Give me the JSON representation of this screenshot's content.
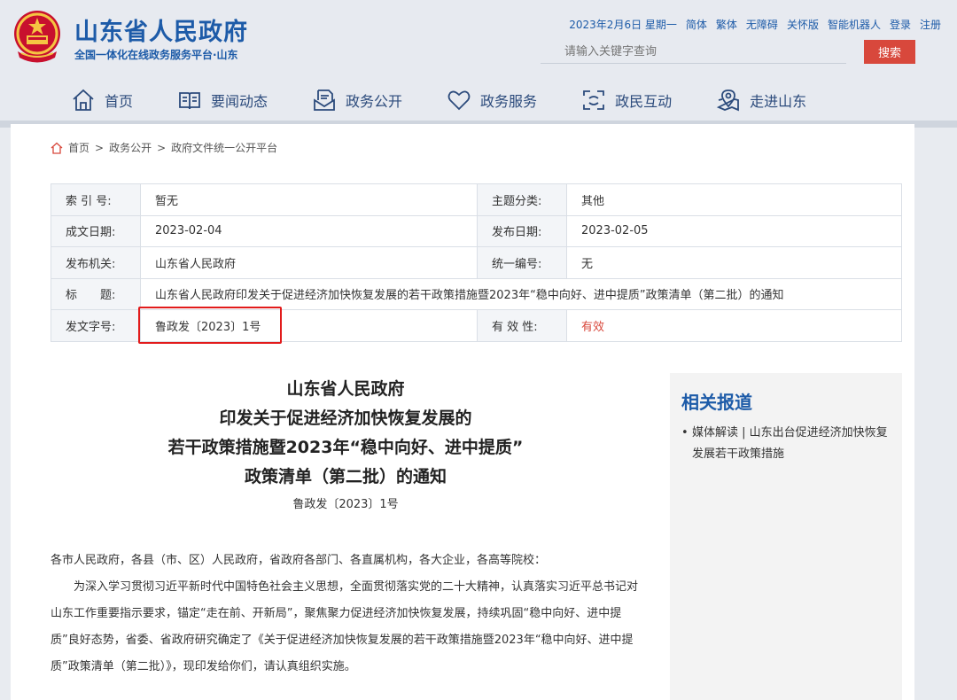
{
  "header": {
    "site_title": "山东省人民政府",
    "site_subtitle": "全国一体化在线政务服务平台·山东",
    "date": "2023年2月6日 星期一",
    "links": [
      "简体",
      "繁体",
      "无障碍",
      "关怀版",
      "智能机器人",
      "登录",
      "注册"
    ],
    "search_placeholder": "请输入关键字查询",
    "search_button": "搜索"
  },
  "nav": [
    {
      "label": "首页",
      "icon": "home-icon"
    },
    {
      "label": "要闻动态",
      "icon": "book-icon"
    },
    {
      "label": "政务公开",
      "icon": "document-icon"
    },
    {
      "label": "政务服务",
      "icon": "heart-icon"
    },
    {
      "label": "政民互动",
      "icon": "interaction-icon"
    },
    {
      "label": "走进山东",
      "icon": "map-pin-icon"
    }
  ],
  "breadcrumb": [
    "首页",
    ">",
    "政务公开",
    ">",
    "政府文件统一公开平台"
  ],
  "meta": {
    "index_label": "索 引 号:",
    "index_value": "暂无",
    "topic_label": "主题分类:",
    "topic_value": "其他",
    "created_label": "成文日期:",
    "created_value": "2023-02-04",
    "published_label": "发布日期:",
    "published_value": "2023-02-05",
    "org_label": "发布机关:",
    "org_value": "山东省人民政府",
    "code_label": "统一编号:",
    "code_value": "无",
    "title_label": "标　　题:",
    "title_value": "山东省人民政府印发关于促进经济加快恢复发展的若干政策措施暨2023年“稳中向好、进中提质”政策清单（第二批）的通知",
    "docnum_label": "发文字号:",
    "docnum_value": "鲁政发〔2023〕1号",
    "validity_label": "有 效 性:",
    "validity_value": "有效"
  },
  "document": {
    "title_lines": [
      "山东省人民政府",
      "印发关于促进经济加快恢复发展的",
      "若干政策措施暨2023年“稳中向好、进中提质”",
      "政策清单（第二批）的通知"
    ],
    "number": "鲁政发〔2023〕1号",
    "salutation": "各市人民政府，各县（市、区）人民政府，省政府各部门、各直属机构，各大企业，各高等院校：",
    "paragraph": "为深入学习贯彻习近平新时代中国特色社会主义思想，全面贯彻落实党的二十大精神，认真落实习近平总书记对山东工作重要指示要求，锚定“走在前、开新局”，聚焦聚力促进经济加快恢复发展，持续巩固“稳中向好、进中提质”良好态势，省委、省政府研究确定了《关于促进经济加快恢复发展的若干政策措施暨2023年“稳中向好、进中提质”政策清单（第二批）》，现印发给你们，请认真组织实施。"
  },
  "sidebar": {
    "title": "相关报道",
    "items": [
      {
        "text": "媒体解读 | 山东出台促进经济加快恢复发展若干政策措施"
      }
    ]
  },
  "colors": {
    "brand_blue": "#1d5ba8",
    "accent_red": "#d8483c",
    "highlight_red": "#e21b1b"
  }
}
